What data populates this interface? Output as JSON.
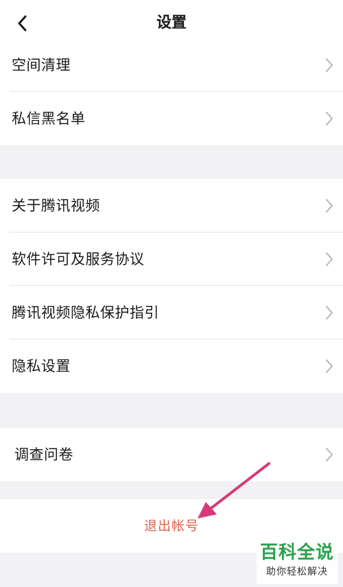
{
  "header": {
    "title": "设置",
    "back_icon": "chevron-left-icon"
  },
  "groups": [
    {
      "items": [
        {
          "label": "空间清理"
        },
        {
          "label": "私信黑名单"
        }
      ]
    },
    {
      "items": [
        {
          "label": "关于腾讯视频"
        },
        {
          "label": "软件许可及服务协议"
        },
        {
          "label": "腾讯视频隐私保护指引"
        },
        {
          "label": "隐私设置"
        }
      ]
    },
    {
      "items": [
        {
          "label": "调查问卷"
        }
      ]
    }
  ],
  "logout": {
    "label": "退出帐号",
    "color": "#e0604e"
  },
  "annotation": {
    "arrow_color": "#d63a79"
  },
  "watermark": {
    "main": "百科全说",
    "sub": "助你轻松解决",
    "color": "#2aa24a"
  }
}
